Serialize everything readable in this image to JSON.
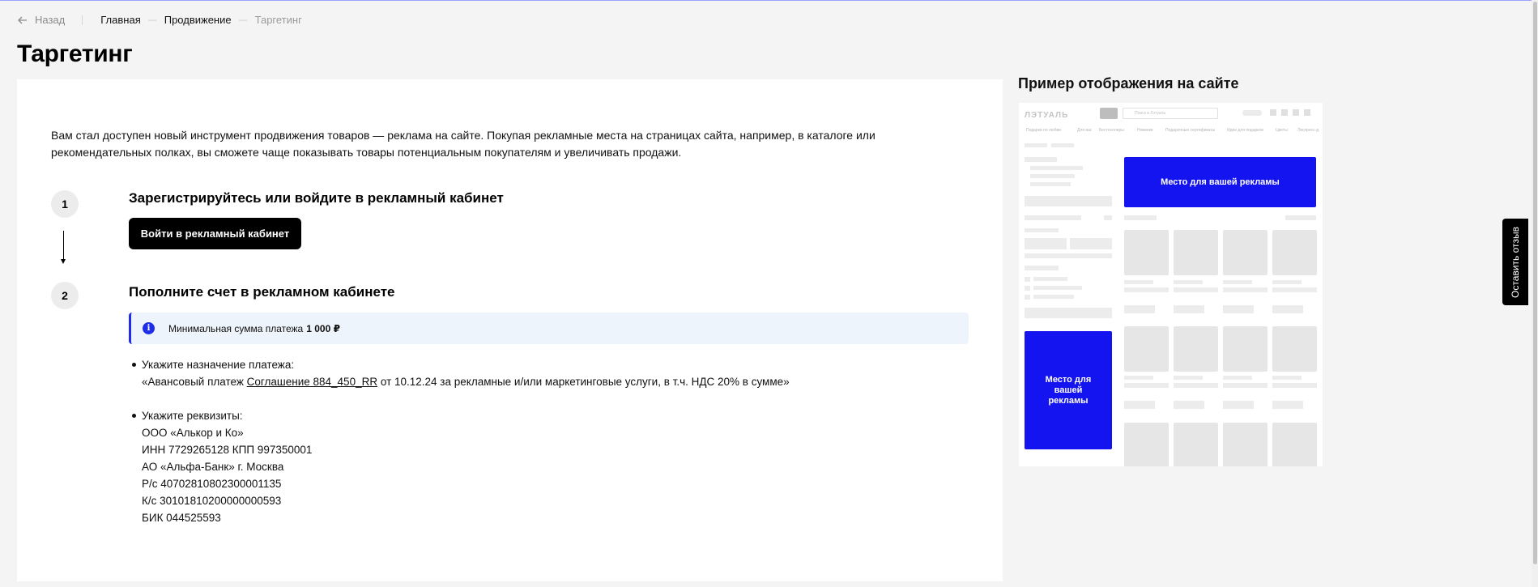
{
  "breadcrumbs": {
    "back_label": "Назад",
    "items": [
      "Главная",
      "Продвижение",
      "Таргетинг"
    ]
  },
  "page_title": "Таргетинг",
  "intro_text": "Вам стал доступен новый инструмент продвижения товаров — реклама на сайте. Покупая рекламные места на страницах сайта, например, в каталоге или рекомендательных полках, вы сможете чаще показывать товары потенциальным покупателям и увеличивать продажи.",
  "steps": [
    {
      "number": "1",
      "title": "Зарегистрируйтесь или войдите в рекламный кабинет",
      "button_label": "Войти в рекламный кабинет"
    },
    {
      "number": "2",
      "title": "Пополните счет в рекламном кабинете"
    }
  ],
  "info": {
    "icon": "i",
    "text": "Минимальная сумма платежа",
    "amount": "1 000 ₽"
  },
  "payment_purpose": {
    "label": "Укажите назначение платежа:",
    "prefix": "«Авансовый платеж",
    "agreement_link": "Соглашение 884_450_RR",
    "suffix": "от 10.12.24 за рекламные и/или маркетинговые услуги, в т.ч. НДС 20% в сумме»"
  },
  "requisites": {
    "label": "Укажите реквизиты:",
    "lines": [
      "ООО «Алькор и Ко»",
      "ИНН 7729265128 КПП 997350001",
      "АО «Альфа-Банк» г. Москва",
      "Р/с 40702810802300001135",
      "К/с 30101810200000000593",
      "БИК 044525593"
    ]
  },
  "preview": {
    "title": "Пример отображения на сайте",
    "logo": "ЛЭТУАЛЬ",
    "search_placeholder": "Поиск в Лэтуаль",
    "nav_items": [
      "Подарки по любви",
      "Для вас",
      "Бестселлеры",
      "Новинки",
      "Подарочные сертификаты",
      "Идеи для подарков",
      "Цветы",
      "Экспресс-д"
    ],
    "ad_banner_top": "Место для вашей рекламы",
    "ad_banner_side": "Место для вашей рекламы"
  },
  "feedback_label": "Оставить отзыв",
  "colors": {
    "accent": "#1414f0",
    "info_bg": "#eef4fb",
    "button_bg": "#000000"
  }
}
